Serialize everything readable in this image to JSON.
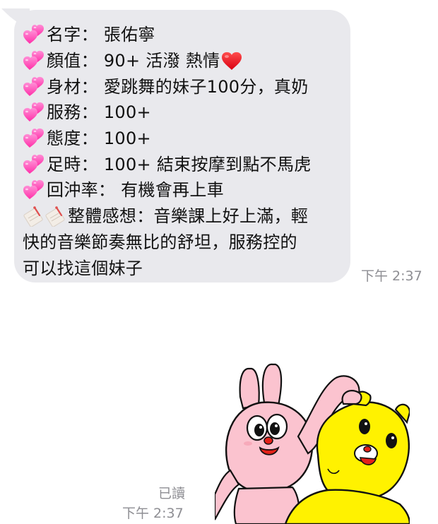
{
  "incoming_message": {
    "lines": [
      {
        "prefix_icon": "two-hearts-icon",
        "text": "名字： 張佑寧"
      },
      {
        "prefix_icon": "two-hearts-icon",
        "text": "顏值： 90+ 活潑 熱情",
        "suffix_icon": "red-heart-icon"
      },
      {
        "prefix_icon": "two-hearts-icon",
        "text": "身材： 愛跳舞的妹子100分，真奶"
      },
      {
        "prefix_icon": "two-hearts-icon",
        "text": "服務：  100+"
      },
      {
        "prefix_icon": "two-hearts-icon",
        "text": "態度：  100+"
      },
      {
        "prefix_icon": "two-hearts-icon",
        "text": "足時：  100+ 結束按摩到點不馬虎"
      },
      {
        "prefix_icon": "two-hearts-icon",
        "text": "回沖率： 有機會再上車"
      },
      {
        "prefix_icon": "memo-icon",
        "prefix_icon_count": 2,
        "text": "整體感想：音樂課上好上滿，輕"
      },
      {
        "text": "快的音樂節奏無比的舒坦，服務控的"
      },
      {
        "text": "可以找這個妹子"
      }
    ],
    "time": "下午 2:37"
  },
  "outgoing_message": {
    "type": "sticker",
    "sticker_icon": "rabbit-and-bear-sticker",
    "read_status": "已讀",
    "time": "下午 2:37"
  },
  "colors": {
    "bubble_bg": "#e9e9ed",
    "text": "#111111",
    "meta_text": "#8e8e93",
    "heart_pink": "#ff3fae",
    "heart_red": "#e8131f",
    "sticker_rabbit": "#fbc3cf",
    "sticker_bear": "#fff200"
  }
}
